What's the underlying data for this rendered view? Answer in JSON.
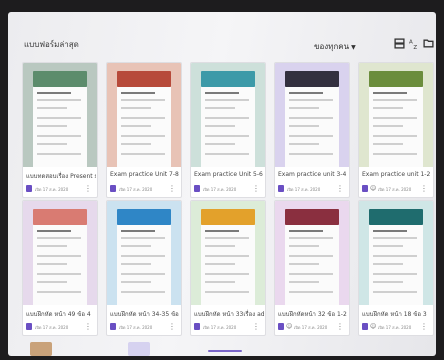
{
  "header": {
    "section_title": "แบบฟอร์มล่าสุด",
    "owner_filter": "ของทุกคน",
    "icons": [
      "grid-view-icon",
      "sort-az-icon",
      "folder-icon"
    ]
  },
  "cards": [
    {
      "title": "แบบทดสอบเรื่อง Present si...",
      "opened": "เปิด 17 ส.ค. 2020",
      "shared": false,
      "banner": "#5c8c6c",
      "bg": "#b9c8c0"
    },
    {
      "title": "Exam practice Unit 7-8",
      "opened": "เปิด 17 ส.ค. 2020",
      "shared": false,
      "banner": "#b74a3a",
      "bg": "#e8c3b6"
    },
    {
      "title": "Exam practice Unit 5-6",
      "opened": "เปิด 17 ส.ค. 2020",
      "shared": false,
      "banner": "#3d9aa8",
      "bg": "#cde0da"
    },
    {
      "title": "Exam practice unit 3-4",
      "opened": "เปิด 17 ส.ค. 2020",
      "shared": false,
      "banner": "#33303f",
      "bg": "#d9d2ee"
    },
    {
      "title": "Exam practice unit 1-2",
      "opened": "เปิด 17 ส.ค. 2020",
      "shared": true,
      "banner": "#6b8d3c",
      "bg": "#dfe6cf"
    },
    {
      "title": "แบบฝึกหัด หน้า 49 ข้อ 4",
      "opened": "เปิด 17 ส.ค. 2020",
      "shared": false,
      "banner": "#d97b72",
      "bg": "#e6d9ec"
    },
    {
      "title": "แบบฝึกหัด หน้า 34-35 ข้อ 1...",
      "opened": "เปิด 17 ส.ค. 2020",
      "shared": false,
      "banner": "#2f86c6",
      "bg": "#cbe2f0"
    },
    {
      "title": "แบบฝึกหัด หน้า 33เรื่อง adje...",
      "opened": "เปิด 17 ส.ค. 2020",
      "shared": false,
      "banner": "#e3a12b",
      "bg": "#dcecd8"
    },
    {
      "title": "แบบฝึกหัดหน้า 32 ข้อ 1-2",
      "opened": "เปิด 17 ส.ค. 2020",
      "shared": true,
      "banner": "#8a2f3f",
      "bg": "#ead8ee"
    },
    {
      "title": "แบบฝึกหัด หน้า 18 ข้อ 3",
      "opened": "เปิด 17 ส.ค. 2020",
      "shared": true,
      "banner": "#1f6c6e",
      "bg": "#cfe6e6"
    }
  ],
  "colors": {
    "forms_purple": "#6a4fc3"
  }
}
